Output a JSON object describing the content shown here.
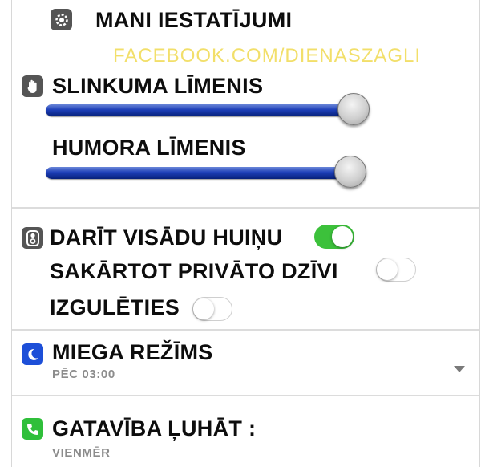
{
  "header": {
    "title": "MANI IESTATĪJUMI",
    "icon": "gear-icon"
  },
  "watermark": "FACEBOOK.COM/DIENASZAGLI",
  "sliders": {
    "icon": "hand-icon",
    "items": [
      {
        "label": "SLINKUMA LĪMENIS",
        "value": 0.95
      },
      {
        "label": "HUMORA LĪMENIS",
        "value": 0.95
      }
    ]
  },
  "toggles": {
    "icon": "toggle-settings-icon",
    "items": [
      {
        "label": "DARĪT VISĀDU HUIŅU",
        "state": "on"
      },
      {
        "label": "SAKĀRTOT PRIVĀTO DZĪVI",
        "state": "off"
      },
      {
        "label": "IZGULĒTIES",
        "state": "off"
      }
    ]
  },
  "sleep_mode": {
    "title": "MIEGA REŽĪMS",
    "value": "PĒC 03:00",
    "icon": "moon-icon"
  },
  "readiness": {
    "title": "GATAVĪBA ĻUHĀT :",
    "value": "VIENMĒR",
    "icon": "phone-icon"
  },
  "colors": {
    "accent_green": "#3cc13b",
    "slider_blue": "#1d3fb8",
    "watermark": "#f2df6a",
    "moon_blue": "#1d4fd8",
    "phone_green": "#2fbf3a"
  }
}
